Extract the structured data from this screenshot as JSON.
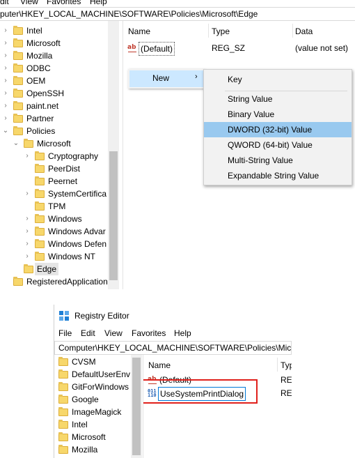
{
  "top": {
    "menu": [
      "dit",
      "View",
      "Favorites",
      "Help"
    ],
    "address": "puter\\HKEY_LOCAL_MACHINE\\SOFTWARE\\Policies\\Microsoft\\Edge",
    "tree": [
      {
        "label": "Intel",
        "chev": "›"
      },
      {
        "label": "Microsoft",
        "chev": "›"
      },
      {
        "label": "Mozilla",
        "chev": "›"
      },
      {
        "label": "ODBC",
        "chev": "›"
      },
      {
        "label": "OEM",
        "chev": "›"
      },
      {
        "label": "OpenSSH",
        "chev": "›"
      },
      {
        "label": "paint.net",
        "chev": "›"
      },
      {
        "label": "Partner",
        "chev": "›"
      },
      {
        "label": "Policies",
        "chev": "⌄"
      },
      {
        "label": "Microsoft",
        "chev": "⌄"
      },
      {
        "label": "Cryptography",
        "chev": "›"
      },
      {
        "label": "PeerDist",
        "chev": ""
      },
      {
        "label": "Peernet",
        "chev": ""
      },
      {
        "label": "SystemCertifica",
        "chev": "›"
      },
      {
        "label": "TPM",
        "chev": ""
      },
      {
        "label": "Windows",
        "chev": "›"
      },
      {
        "label": "Windows Advar",
        "chev": "›"
      },
      {
        "label": "Windows Defen",
        "chev": "›"
      },
      {
        "label": "Windows NT",
        "chev": "›"
      },
      {
        "label": "Edge",
        "chev": ""
      },
      {
        "label": "RegisteredApplication",
        "chev": ""
      }
    ],
    "columns": {
      "name": "Name",
      "type": "Type",
      "data": "Data"
    },
    "value": {
      "name": "(Default)",
      "type": "REG_SZ",
      "data": "(value not set)",
      "icon": "ab-string-icon"
    },
    "context_menu": {
      "label": "New",
      "arrow": "›"
    },
    "submenu": [
      "Key",
      "String Value",
      "Binary Value",
      "DWORD (32-bit) Value",
      "QWORD (64-bit) Value",
      "Multi-String Value",
      "Expandable String Value"
    ],
    "highlighted_submenu_index": 3
  },
  "bottom": {
    "title": "Registry Editor",
    "menu": [
      "File",
      "Edit",
      "View",
      "Favorites",
      "Help"
    ],
    "address": "Computer\\HKEY_LOCAL_MACHINE\\SOFTWARE\\Policies\\Micros",
    "tree": [
      "CVSM",
      "DefaultUserEnv",
      "GitForWindows",
      "Google",
      "ImageMagick",
      "Intel",
      "Microsoft",
      "Mozilla"
    ],
    "columns": {
      "name": "Name",
      "type": "Typ"
    },
    "values": [
      {
        "name": "(Default)",
        "type": "REG",
        "icon": "ab-string-icon"
      },
      {
        "name": "UseSystemPrintDialog",
        "type": "REG",
        "icon": "dword-icon"
      }
    ],
    "highlight_color": "#e0201b"
  }
}
